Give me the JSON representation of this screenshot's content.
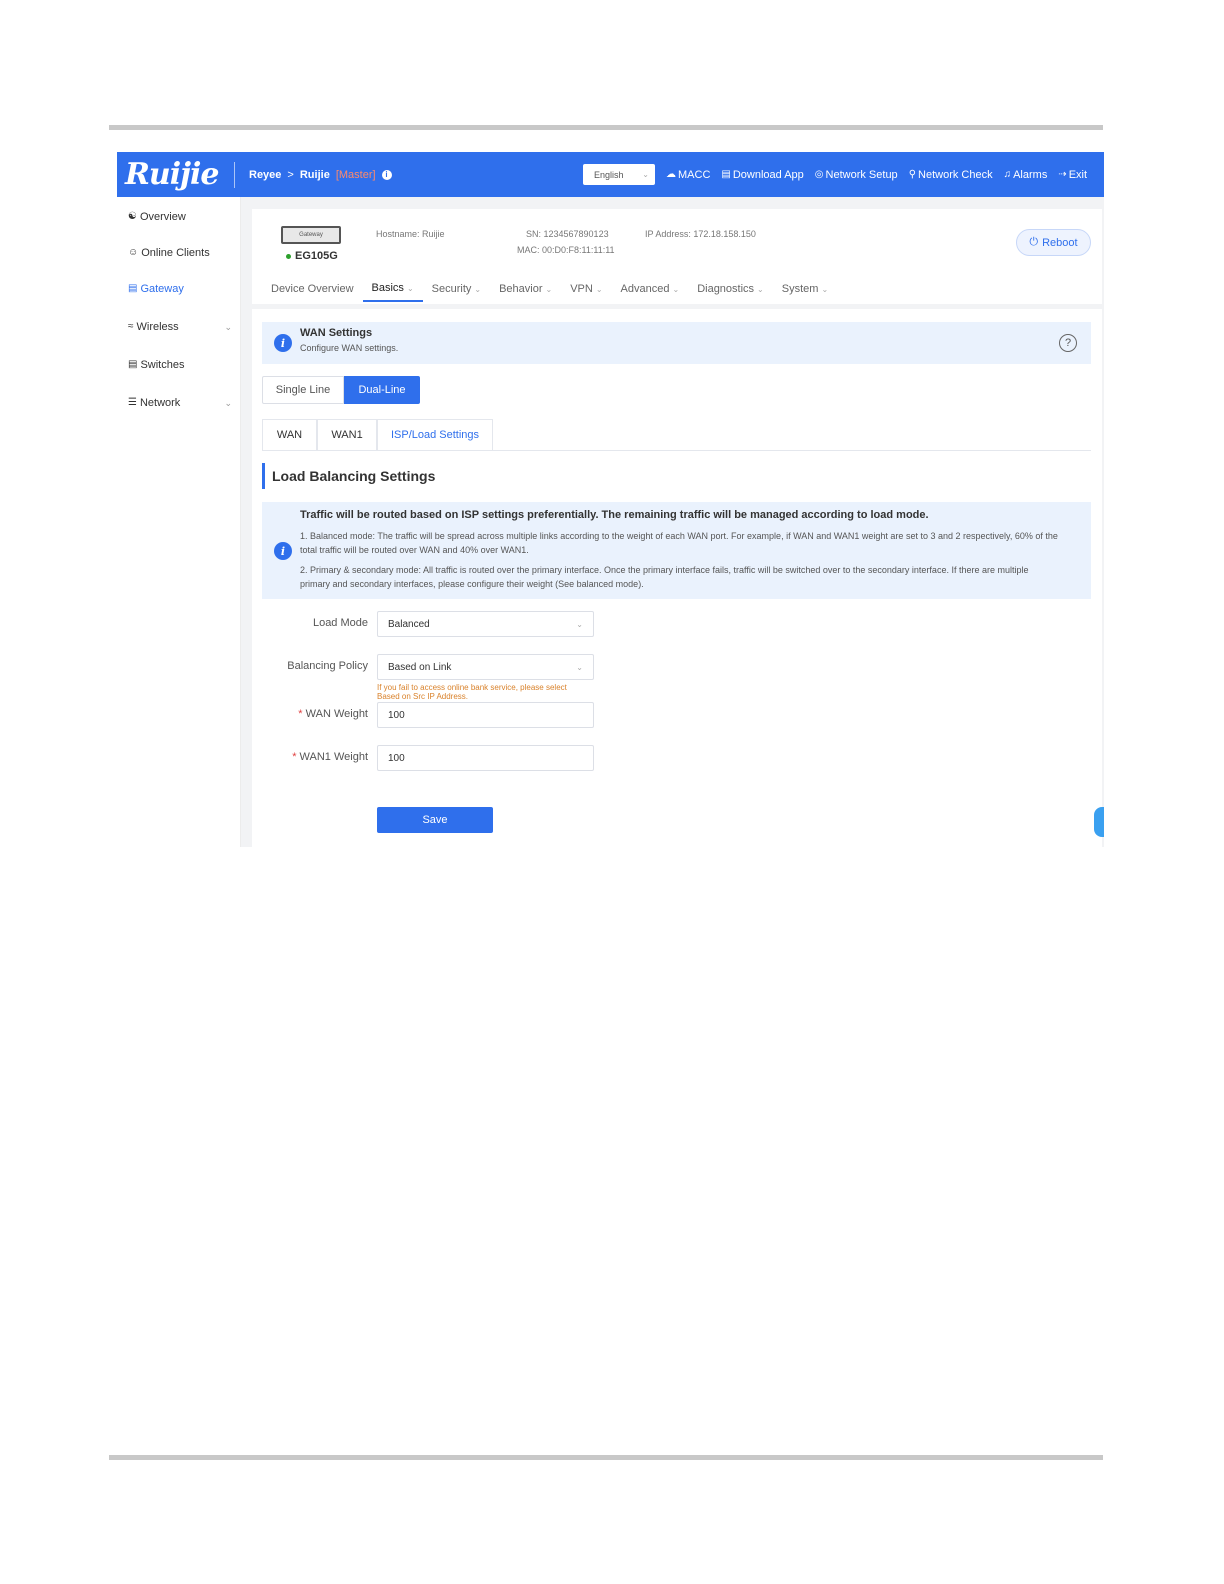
{
  "topbar": {
    "logo": "Ruijie",
    "crumb_root": "Reyee",
    "crumb_sep": ">",
    "crumb_device": "Ruijie",
    "crumb_role": "[Master]",
    "language": "English",
    "nav": [
      {
        "label": "MACC",
        "icon": "cloud-icon"
      },
      {
        "label": "Download App",
        "icon": "download-icon"
      },
      {
        "label": "Network Setup",
        "icon": "network-setup-icon"
      },
      {
        "label": "Network Check",
        "icon": "network-check-icon"
      },
      {
        "label": "Alarms",
        "icon": "alarm-icon"
      },
      {
        "label": "Exit",
        "icon": "exit-icon"
      }
    ]
  },
  "sidebar": {
    "items": [
      {
        "label": "Overview",
        "icon": "overview-icon"
      },
      {
        "label": "Online Clients",
        "icon": "clients-icon"
      },
      {
        "label": "Gateway",
        "icon": "gateway-icon",
        "active": true
      },
      {
        "label": "Wireless",
        "icon": "wifi-icon"
      },
      {
        "label": "Switches",
        "icon": "switch-icon"
      },
      {
        "label": "Network",
        "icon": "network-icon"
      }
    ]
  },
  "device": {
    "image_label": "Gateway",
    "model": "EG105G",
    "hostname": "Hostname: Ruijie",
    "sn": "SN: 1234567890123",
    "mac": "MAC: 00:D0:F8:11:11:11",
    "ip": "IP Address: 172.18.158.150",
    "reboot": "Reboot"
  },
  "tabs": [
    "Device Overview",
    "Basics",
    "Security",
    "Behavior",
    "VPN",
    "Advanced",
    "Diagnostics",
    "System"
  ],
  "active_tab": "Basics",
  "wan_banner": {
    "title": "WAN Settings",
    "subtitle": "Configure WAN settings."
  },
  "line_mode": {
    "options": [
      "Single Line",
      "Dual-Line"
    ],
    "selected": "Dual-Line"
  },
  "subtabs": [
    "WAN",
    "WAN1",
    "ISP/Load Settings"
  ],
  "active_subtab": "ISP/Load Settings",
  "section_title": "Load Balancing Settings",
  "lb_banner": {
    "title": "Traffic will be routed based on ISP settings preferentially. The remaining traffic will be managed according to load mode.",
    "line1": "1. Balanced mode: The traffic will be spread across multiple links according to the weight of each WAN port. For example, if WAN and WAN1 weight are set to 3 and 2 respectively, 60% of the total traffic will be routed over WAN and 40% over WAN1.",
    "line2": "2. Primary & secondary mode: All traffic is routed over the primary interface. Once the primary interface fails, traffic will be switched over to the secondary interface. If there are multiple primary and secondary interfaces, please configure their weight (See balanced mode)."
  },
  "form": {
    "load_mode_label": "Load Mode",
    "load_mode_value": "Balanced",
    "policy_label": "Balancing Policy",
    "policy_value": "Based on Link",
    "policy_hint": "If you fail to access online bank service, please select Based on Src IP Address.",
    "wan_weight_label": "WAN Weight",
    "wan_weight_value": "100",
    "wan1_weight_label": "WAN1 Weight",
    "wan1_weight_value": "100",
    "required_mark": "*",
    "save": "Save"
  }
}
